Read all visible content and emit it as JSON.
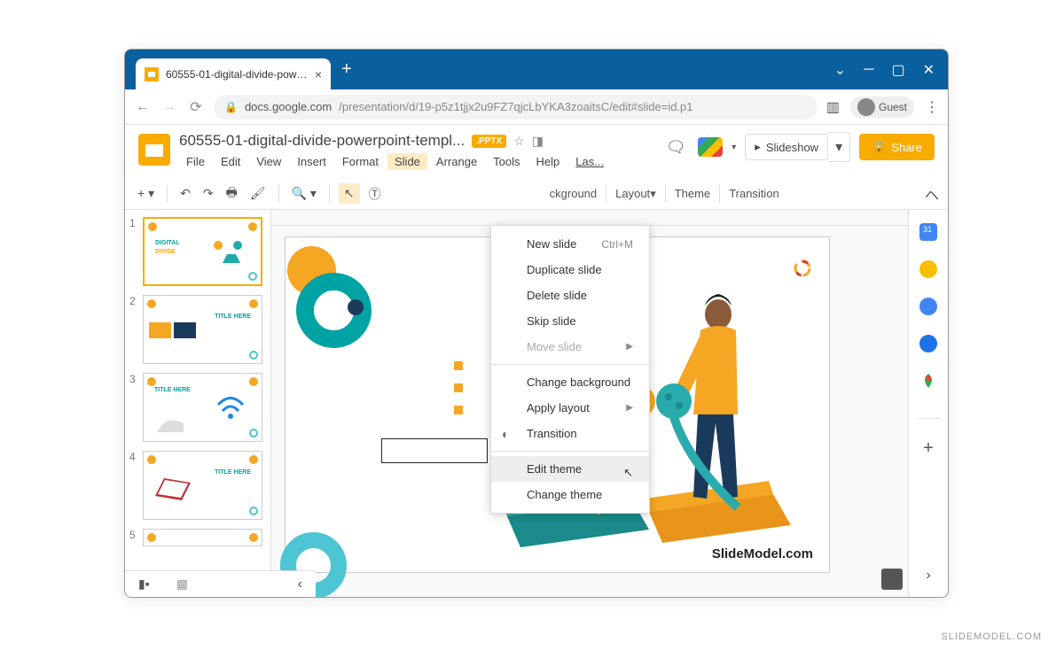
{
  "browser": {
    "tab_title": "60555-01-digital-divide-powerpc",
    "url_host": "docs.google.com",
    "url_path": "/presentation/d/19-p5z1tjjx2u9FZ7qjcLbYKA3zoaitsC/edit#slide=id.p1",
    "guest_label": "Guest"
  },
  "doc": {
    "title": "60555-01-digital-divide-powerpoint-templ...",
    "badge": ".PPTX"
  },
  "menus": {
    "file": "File",
    "edit": "Edit",
    "view": "View",
    "insert": "Insert",
    "format": "Format",
    "slide": "Slide",
    "arrange": "Arrange",
    "tools": "Tools",
    "help": "Help",
    "last": "Las..."
  },
  "actions": {
    "slideshow": "Slideshow",
    "share": "Share"
  },
  "toolbar": {
    "background": "ckground",
    "layout": "Layout",
    "theme": "Theme",
    "transition": "Transition"
  },
  "dropdown": {
    "new_slide": "New slide",
    "new_slide_shortcut": "Ctrl+M",
    "duplicate": "Duplicate slide",
    "delete": "Delete slide",
    "skip": "Skip slide",
    "move": "Move slide",
    "change_bg": "Change background",
    "apply_layout": "Apply layout",
    "transition": "Transition",
    "edit_theme": "Edit theme",
    "change_theme": "Change theme"
  },
  "slides": {
    "nums": [
      "1",
      "2",
      "3",
      "4",
      "5"
    ],
    "thumb_title_1a": "DIGITAL",
    "thumb_title_1b": "DIVIDE",
    "thumb_title_generic": "TITLE HERE"
  },
  "canvas": {
    "footer": "SlideModel.com"
  },
  "watermark": "SLIDEMODEL.COM"
}
